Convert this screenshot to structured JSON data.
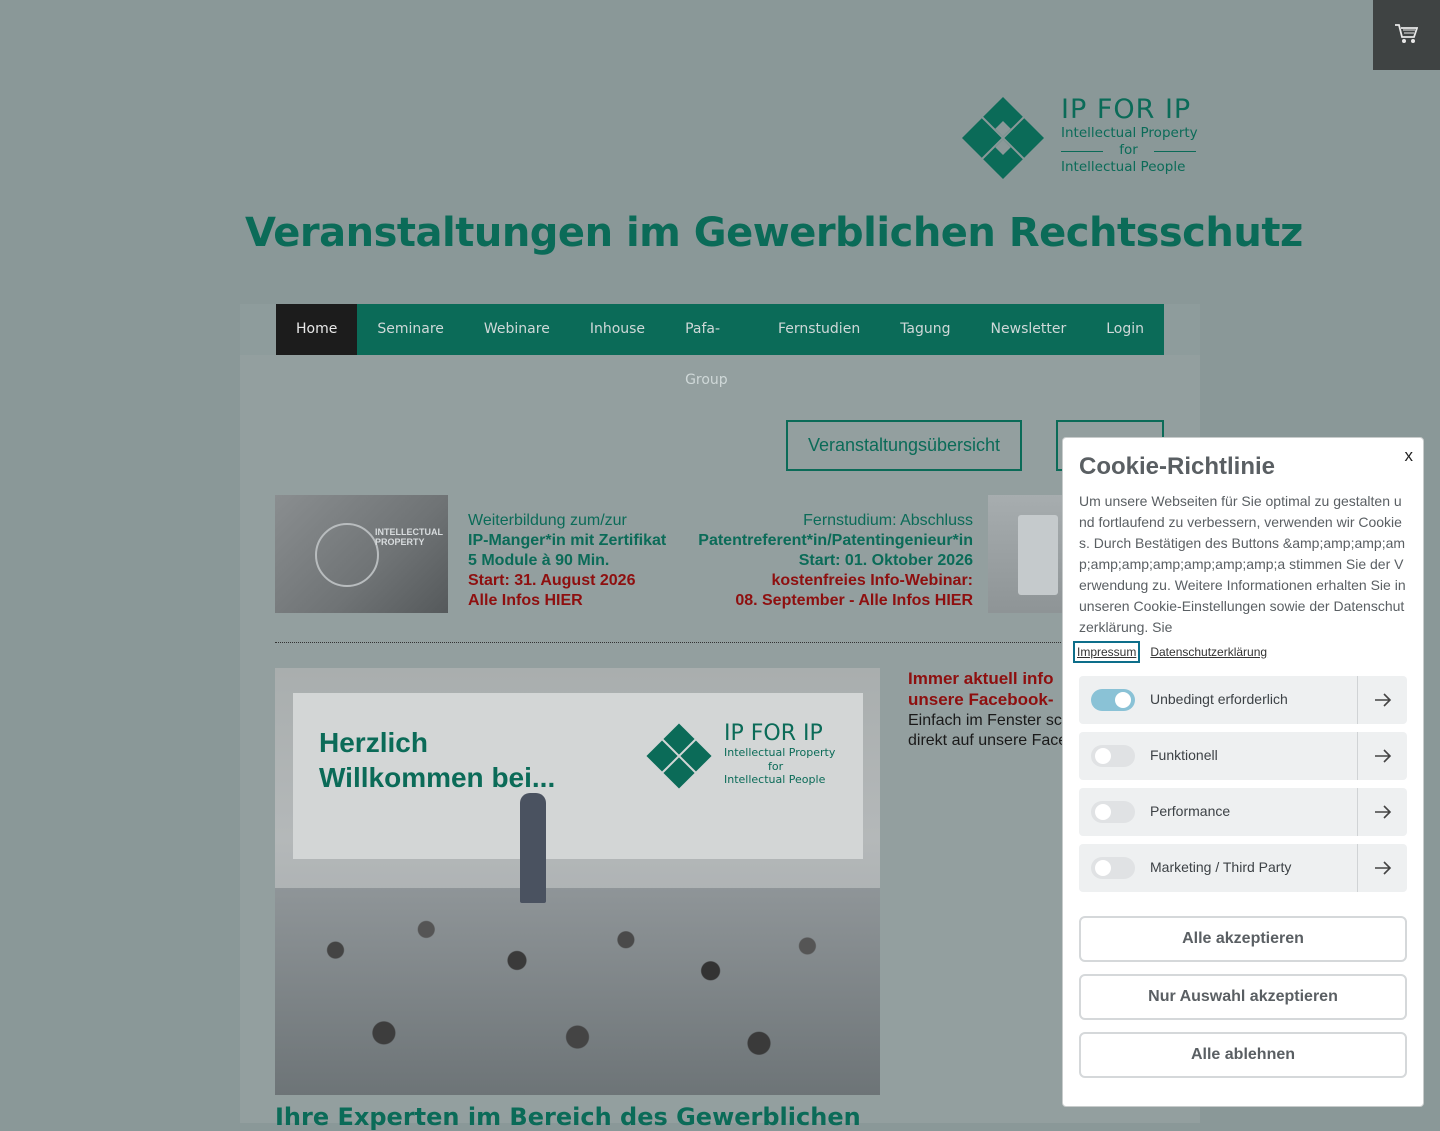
{
  "logo": {
    "word": "IP FOR IP",
    "line1": "Intellectual Property",
    "line2": "for",
    "line3": "Intellectual People"
  },
  "site_title": "Veranstaltungen im Gewerblichen Rechtsschutz",
  "nav": [
    "Home",
    "Seminare",
    "Webinare",
    "Inhouse",
    "Pafa-Group",
    "Fernstudien",
    "Tagung",
    "Newsletter",
    "Login"
  ],
  "buttons": {
    "overview": "Veranstaltungsübersicht"
  },
  "promo_left": {
    "l1": "Weiterbildung zum/zur",
    "l2": "IP-Manger*in mit Zertifikat",
    "l3": "5 Module à 90 Min.",
    "l4": "Start: 31. August 2026",
    "l5": "Alle Infos HIER"
  },
  "promo_image_text": "INTELLECTUAL PROPERTY",
  "promo_right": {
    "l1": "Fernstudium: Abschluss",
    "l2": "Patentreferent*in/Patentingenieur*in",
    "l3": "Start: 01. Oktober 2026",
    "l4": "kostenfreies Info-Webinar:",
    "l5": "08. September - Alle Infos HIER"
  },
  "hero": {
    "welcome": "Herzlich\nWillkommen bei..."
  },
  "facebook": {
    "title": "Immer aktuell info\nunsere Facebook-",
    "text": "Einfach im Fenster sc\ndirekt auf unsere Face"
  },
  "experts_heading": "Ihre Experten im Bereich des Gewerblichen",
  "cookie": {
    "close": "x",
    "title": "Cookie-Richtlinie",
    "text": "Um unsere Webseiten für Sie optimal zu gestalten und fortlaufend zu verbessern, verwenden wir Cookies. Durch Bestätigen des Buttons &amp;amp;amp;amp;amp;amp;amp;amp;amp;amp;a stimmen Sie der Verwendung zu. Weitere Informationen erhalten Sie in unseren Cookie-Einstellungen sowie der Datenschutzerklärung. Sie",
    "links": [
      "Impressum",
      "Datenschutzerklärung"
    ],
    "options": [
      {
        "label": "Unbedingt erforderlich",
        "enabled": true
      },
      {
        "label": "Funktionell",
        "enabled": false
      },
      {
        "label": "Performance",
        "enabled": false
      },
      {
        "label": "Marketing / Third Party",
        "enabled": false
      }
    ],
    "accept_all": "Alle akzeptieren",
    "accept_selection": "Nur Auswahl akzeptieren",
    "reject_all": "Alle ablehnen"
  },
  "colors": {
    "brand_green": "#0b6b58",
    "accent_red": "#8e0f0f",
    "toggle_on": "#8ac2d6"
  }
}
